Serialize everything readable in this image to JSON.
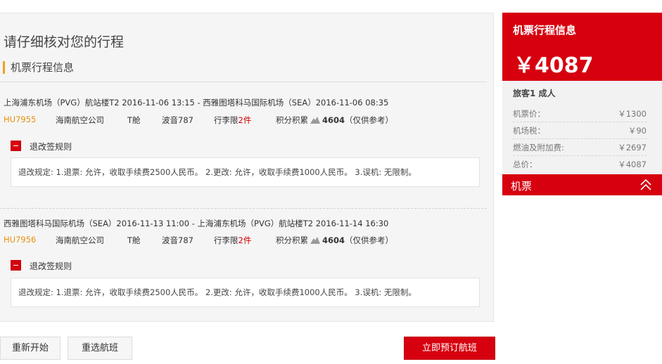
{
  "page": {
    "title": "请仔细核对您的行程",
    "section": "机票行程信息"
  },
  "segments": [
    {
      "route": "上海浦东机场（PVG）航站楼T2 2016-11-06 13:15 - 西雅图塔科马国际机场（SEA）2016-11-06 08:35",
      "flight_no": "HU7955",
      "airline": "海南航空公司",
      "cabin": "T舱",
      "aircraft": "波音787",
      "baggage_label": "行李限",
      "baggage_value": "2件",
      "points_label": "积分积累",
      "points_value": "4604",
      "points_note": "（仅供参考）",
      "rule_title": "退改签规则",
      "rule_text": "退改规定: 1.退票: 允许，收取手续费2500人民币。 2.更改: 允许，收取手续费1000人民币。 3.误机: 无限制。"
    },
    {
      "route": "西雅图塔科马国际机场（SEA）2016-11-13 11:00 - 上海浦东机场（PVG）航站楼T2 2016-11-14 16:30",
      "flight_no": "HU7956",
      "airline": "海南航空公司",
      "cabin": "T舱",
      "aircraft": "波音787",
      "baggage_label": "行李限",
      "baggage_value": "2件",
      "points_label": "积分积累",
      "points_value": "4604",
      "points_note": "（仅供参考）",
      "rule_title": "退改签规则",
      "rule_text": "退改规定: 1.退票: 允许，收取手续费2500人民币。 2.更改: 允许，收取手续费1000人民币。 3.误机: 无限制。"
    }
  ],
  "buttons": {
    "restart": "重新开始",
    "reselect": "重选航班",
    "book": "立即预订航班"
  },
  "summary": {
    "title": "机票行程信息",
    "total_price": "￥4087",
    "passenger": "旅客1  成人",
    "rows": [
      {
        "label": "机票价：",
        "value": "￥1300"
      },
      {
        "label": "机场税：",
        "value": "￥90"
      },
      {
        "label": "燃油及附加费:",
        "value": "￥2697"
      },
      {
        "label": "总价：",
        "value": "￥4087"
      }
    ],
    "bar_label": "机票"
  },
  "colors": {
    "accent": "#d7000f",
    "flight_no": "#e8900c",
    "section_marker": "#f0a020"
  },
  "icons": {
    "rule_toggle": "minus-square-icon",
    "points": "points-icon",
    "collapse": "double-chevron-up-icon"
  }
}
